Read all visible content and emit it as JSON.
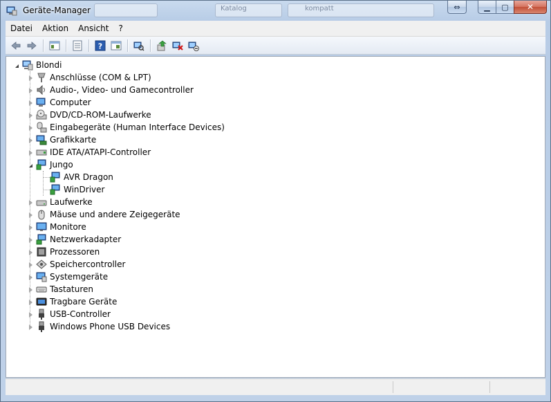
{
  "window": {
    "title": "Geräte-Manager"
  },
  "titlebar": {
    "minimize_glyph": "▁",
    "maximize_glyph": "▢",
    "close_glyph": "✕",
    "resize_glyph": "⇔"
  },
  "background_titles": [
    "Katalog",
    "kompatt"
  ],
  "menu": [
    "Datei",
    "Aktion",
    "Ansicht",
    "?"
  ],
  "toolbar": [
    "back-icon",
    "forward-icon",
    "show-hide-console-tree-icon",
    "properties-icon",
    "help-icon",
    "view-icon",
    "scan-hardware-icon",
    "update-driver-icon",
    "uninstall-icon",
    "disable-icon"
  ],
  "tree": {
    "root": "Blondi",
    "items": [
      {
        "label": "Anschlüsse (COM & LPT)",
        "icon": "port-icon"
      },
      {
        "label": "Audio-, Video- und Gamecontroller",
        "icon": "speaker-icon"
      },
      {
        "label": "Computer",
        "icon": "computer-icon"
      },
      {
        "label": "DVD/CD-ROM-Laufwerke",
        "icon": "optical-drive-icon"
      },
      {
        "label": "Eingabegeräte (Human Interface Devices)",
        "icon": "hid-icon"
      },
      {
        "label": "Grafikkarte",
        "icon": "display-adapter-icon"
      },
      {
        "label": "IDE ATA/ATAPI-Controller",
        "icon": "ide-controller-icon"
      },
      {
        "label": "Jungo",
        "icon": "jungo-icon",
        "expanded": true,
        "children": [
          "AVR Dragon",
          "WinDriver"
        ]
      },
      {
        "label": "Laufwerke",
        "icon": "disk-drive-icon"
      },
      {
        "label": "Mäuse und andere Zeigegeräte",
        "icon": "mouse-icon"
      },
      {
        "label": "Monitore",
        "icon": "monitor-icon"
      },
      {
        "label": "Netzwerkadapter",
        "icon": "network-adapter-icon"
      },
      {
        "label": "Prozessoren",
        "icon": "processor-icon"
      },
      {
        "label": "Speichercontroller",
        "icon": "storage-controller-icon"
      },
      {
        "label": "Systemgeräte",
        "icon": "system-device-icon"
      },
      {
        "label": "Tastaturen",
        "icon": "keyboard-icon"
      },
      {
        "label": "Tragbare Geräte",
        "icon": "portable-device-icon"
      },
      {
        "label": "USB-Controller",
        "icon": "usb-icon"
      },
      {
        "label": "Windows Phone USB Devices",
        "icon": "phone-usb-icon"
      }
    ]
  },
  "colors": {
    "title_bar": "#bfd1e8",
    "close_button": "#c24f37",
    "tree_background": "#ffffff"
  }
}
